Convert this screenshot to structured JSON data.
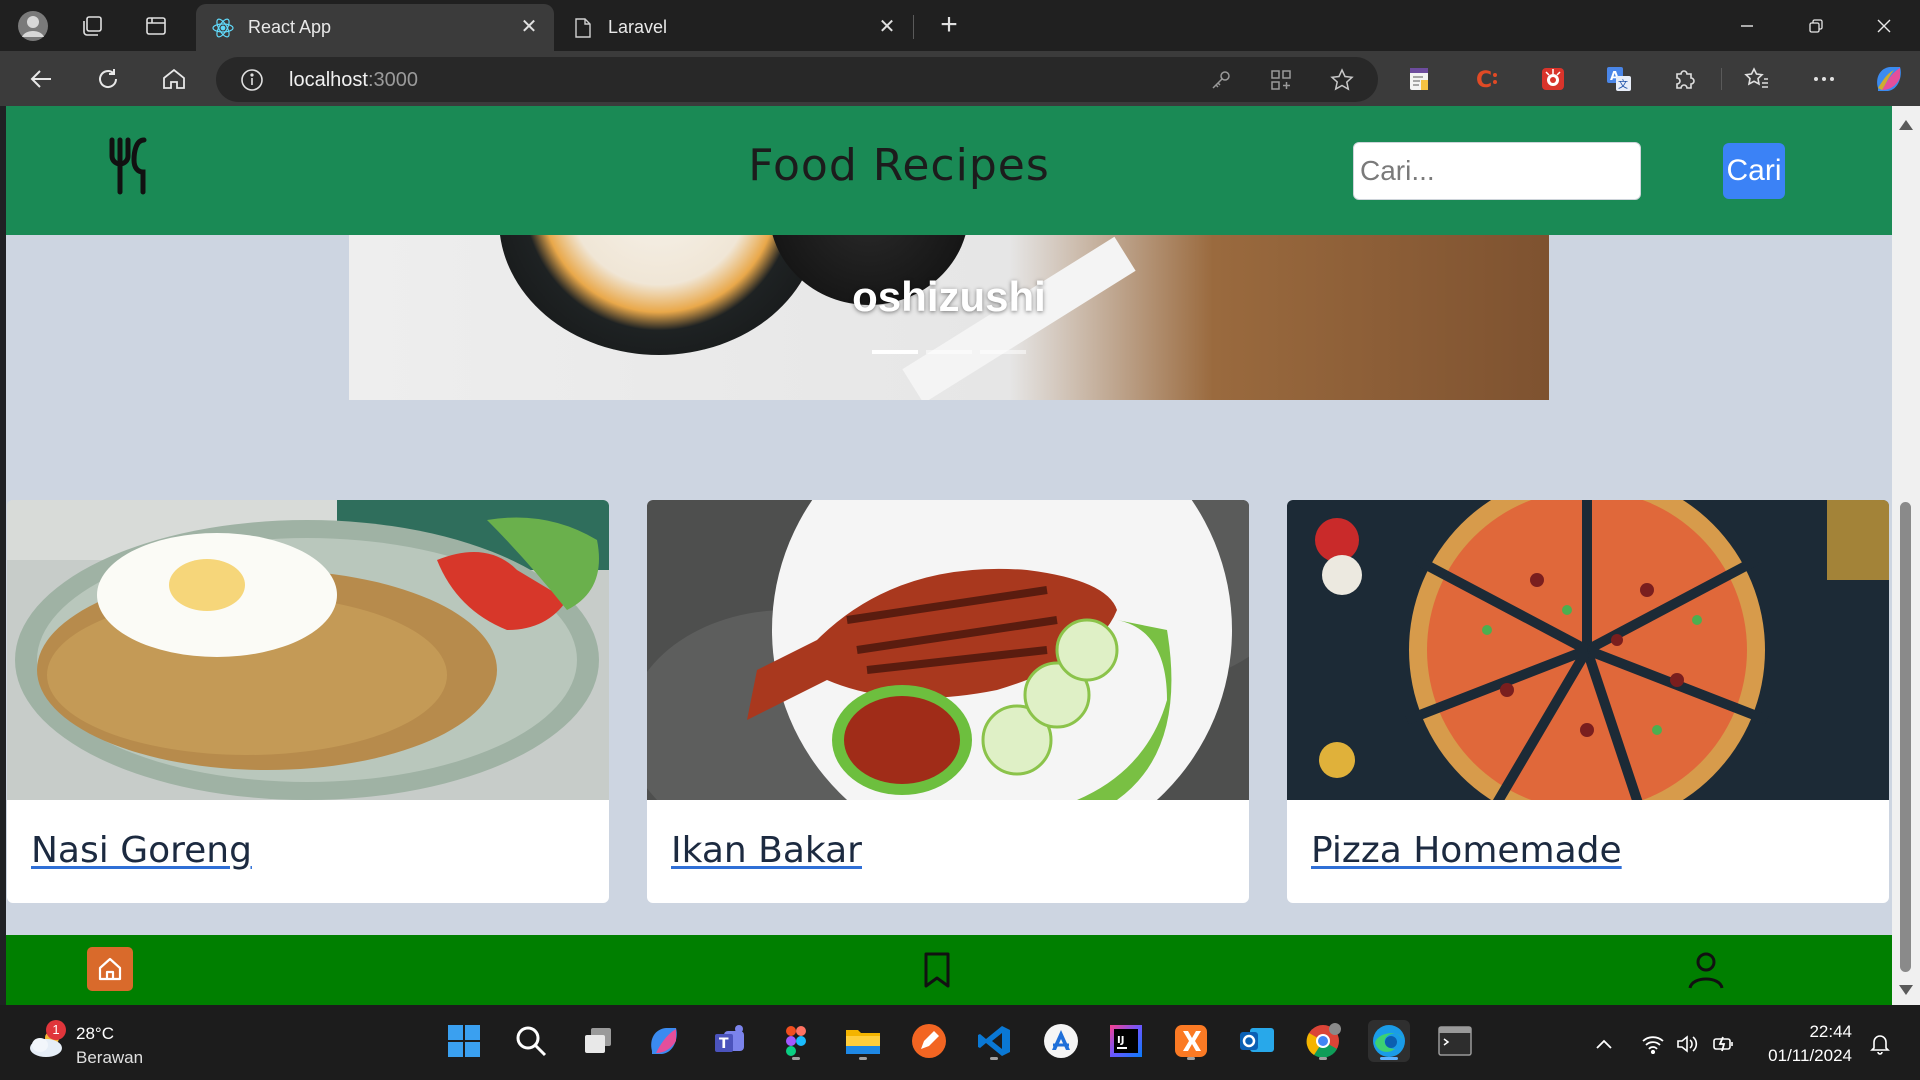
{
  "browser": {
    "tabs": [
      {
        "title": "React App",
        "active": true,
        "icon": "react-icon"
      },
      {
        "title": "Laravel",
        "active": false,
        "icon": "page-icon"
      }
    ],
    "url_host": "localhost",
    "url_port": ":3000"
  },
  "app": {
    "title": "Food Recipes",
    "search": {
      "placeholder": "Cari...",
      "button_label": "Cari"
    },
    "carousel": {
      "caption": "oshizushi",
      "slides": 3,
      "active_slide": 1
    },
    "recipes": [
      {
        "title": "Nasi Goreng",
        "image": "nasi-goreng-image"
      },
      {
        "title": "Ikan Bakar",
        "image": "ikan-bakar-image"
      },
      {
        "title": "Pizza Homemade",
        "image": "pizza-image"
      }
    ],
    "bottom_nav": [
      {
        "name": "home",
        "icon": "home-icon",
        "active": true
      },
      {
        "name": "bookmark",
        "icon": "bookmark-icon",
        "active": false
      },
      {
        "name": "profile",
        "icon": "user-icon",
        "active": false
      }
    ],
    "colors": {
      "header": "#1a8a55",
      "bottom_nav": "#007f00",
      "page_bg": "#cdd5e1",
      "search_button": "#3b82f6",
      "home_active": "#d96a2b"
    }
  },
  "taskbar": {
    "weather": {
      "temp": "28°C",
      "desc": "Berawan",
      "badge": "1"
    },
    "clock": {
      "time": "22:44",
      "date": "01/11/2024"
    }
  }
}
